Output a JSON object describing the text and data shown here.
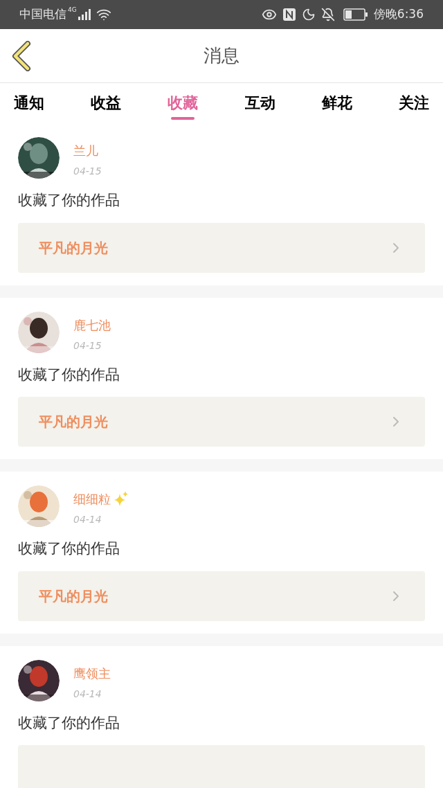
{
  "status_bar": {
    "carrier": "中国电信",
    "network": "4G",
    "time": "傍晚6:36"
  },
  "header": {
    "title": "消息"
  },
  "tabs": [
    {
      "label": "通知",
      "selected": false
    },
    {
      "label": "收益",
      "selected": false
    },
    {
      "label": "收藏",
      "selected": true
    },
    {
      "label": "互动",
      "selected": false
    },
    {
      "label": "鲜花",
      "selected": false
    },
    {
      "label": "关注",
      "selected": false
    }
  ],
  "messages": [
    {
      "name": "兰儿",
      "sparkle": false,
      "date": "04-15",
      "text": "收藏了你的作品",
      "work": "平凡的月光"
    },
    {
      "name": "鹿七池",
      "sparkle": false,
      "date": "04-15",
      "text": "收藏了你的作品",
      "work": "平凡的月光"
    },
    {
      "name": "细细粒",
      "sparkle": true,
      "date": "04-14",
      "text": "收藏了你的作品",
      "work": "平凡的月光"
    },
    {
      "name": "鹰领主",
      "sparkle": false,
      "date": "04-14",
      "text": "收藏了你的作品"
    }
  ]
}
